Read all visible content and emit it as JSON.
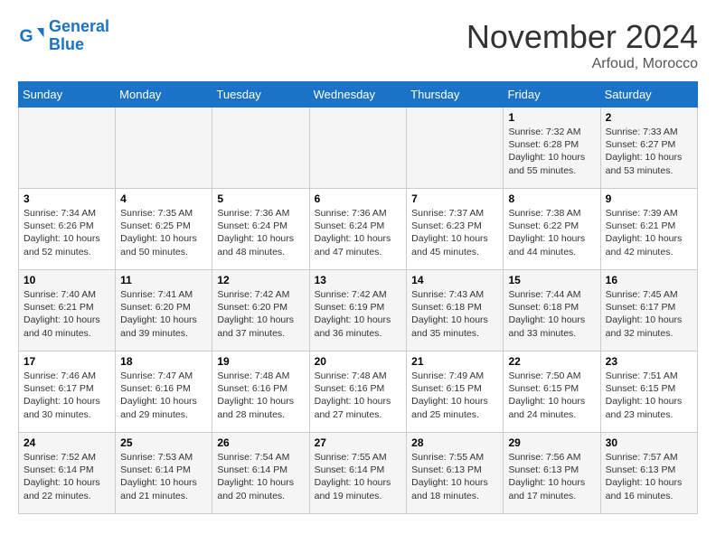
{
  "header": {
    "logo_line1": "General",
    "logo_line2": "Blue",
    "month": "November 2024",
    "location": "Arfoud, Morocco"
  },
  "weekdays": [
    "Sunday",
    "Monday",
    "Tuesday",
    "Wednesday",
    "Thursday",
    "Friday",
    "Saturday"
  ],
  "weeks": [
    [
      {
        "day": "",
        "info": ""
      },
      {
        "day": "",
        "info": ""
      },
      {
        "day": "",
        "info": ""
      },
      {
        "day": "",
        "info": ""
      },
      {
        "day": "",
        "info": ""
      },
      {
        "day": "1",
        "info": "Sunrise: 7:32 AM\nSunset: 6:28 PM\nDaylight: 10 hours\nand 55 minutes."
      },
      {
        "day": "2",
        "info": "Sunrise: 7:33 AM\nSunset: 6:27 PM\nDaylight: 10 hours\nand 53 minutes."
      }
    ],
    [
      {
        "day": "3",
        "info": "Sunrise: 7:34 AM\nSunset: 6:26 PM\nDaylight: 10 hours\nand 52 minutes."
      },
      {
        "day": "4",
        "info": "Sunrise: 7:35 AM\nSunset: 6:25 PM\nDaylight: 10 hours\nand 50 minutes."
      },
      {
        "day": "5",
        "info": "Sunrise: 7:36 AM\nSunset: 6:24 PM\nDaylight: 10 hours\nand 48 minutes."
      },
      {
        "day": "6",
        "info": "Sunrise: 7:36 AM\nSunset: 6:24 PM\nDaylight: 10 hours\nand 47 minutes."
      },
      {
        "day": "7",
        "info": "Sunrise: 7:37 AM\nSunset: 6:23 PM\nDaylight: 10 hours\nand 45 minutes."
      },
      {
        "day": "8",
        "info": "Sunrise: 7:38 AM\nSunset: 6:22 PM\nDaylight: 10 hours\nand 44 minutes."
      },
      {
        "day": "9",
        "info": "Sunrise: 7:39 AM\nSunset: 6:21 PM\nDaylight: 10 hours\nand 42 minutes."
      }
    ],
    [
      {
        "day": "10",
        "info": "Sunrise: 7:40 AM\nSunset: 6:21 PM\nDaylight: 10 hours\nand 40 minutes."
      },
      {
        "day": "11",
        "info": "Sunrise: 7:41 AM\nSunset: 6:20 PM\nDaylight: 10 hours\nand 39 minutes."
      },
      {
        "day": "12",
        "info": "Sunrise: 7:42 AM\nSunset: 6:20 PM\nDaylight: 10 hours\nand 37 minutes."
      },
      {
        "day": "13",
        "info": "Sunrise: 7:42 AM\nSunset: 6:19 PM\nDaylight: 10 hours\nand 36 minutes."
      },
      {
        "day": "14",
        "info": "Sunrise: 7:43 AM\nSunset: 6:18 PM\nDaylight: 10 hours\nand 35 minutes."
      },
      {
        "day": "15",
        "info": "Sunrise: 7:44 AM\nSunset: 6:18 PM\nDaylight: 10 hours\nand 33 minutes."
      },
      {
        "day": "16",
        "info": "Sunrise: 7:45 AM\nSunset: 6:17 PM\nDaylight: 10 hours\nand 32 minutes."
      }
    ],
    [
      {
        "day": "17",
        "info": "Sunrise: 7:46 AM\nSunset: 6:17 PM\nDaylight: 10 hours\nand 30 minutes."
      },
      {
        "day": "18",
        "info": "Sunrise: 7:47 AM\nSunset: 6:16 PM\nDaylight: 10 hours\nand 29 minutes."
      },
      {
        "day": "19",
        "info": "Sunrise: 7:48 AM\nSunset: 6:16 PM\nDaylight: 10 hours\nand 28 minutes."
      },
      {
        "day": "20",
        "info": "Sunrise: 7:48 AM\nSunset: 6:16 PM\nDaylight: 10 hours\nand 27 minutes."
      },
      {
        "day": "21",
        "info": "Sunrise: 7:49 AM\nSunset: 6:15 PM\nDaylight: 10 hours\nand 25 minutes."
      },
      {
        "day": "22",
        "info": "Sunrise: 7:50 AM\nSunset: 6:15 PM\nDaylight: 10 hours\nand 24 minutes."
      },
      {
        "day": "23",
        "info": "Sunrise: 7:51 AM\nSunset: 6:15 PM\nDaylight: 10 hours\nand 23 minutes."
      }
    ],
    [
      {
        "day": "24",
        "info": "Sunrise: 7:52 AM\nSunset: 6:14 PM\nDaylight: 10 hours\nand 22 minutes."
      },
      {
        "day": "25",
        "info": "Sunrise: 7:53 AM\nSunset: 6:14 PM\nDaylight: 10 hours\nand 21 minutes."
      },
      {
        "day": "26",
        "info": "Sunrise: 7:54 AM\nSunset: 6:14 PM\nDaylight: 10 hours\nand 20 minutes."
      },
      {
        "day": "27",
        "info": "Sunrise: 7:55 AM\nSunset: 6:14 PM\nDaylight: 10 hours\nand 19 minutes."
      },
      {
        "day": "28",
        "info": "Sunrise: 7:55 AM\nSunset: 6:13 PM\nDaylight: 10 hours\nand 18 minutes."
      },
      {
        "day": "29",
        "info": "Sunrise: 7:56 AM\nSunset: 6:13 PM\nDaylight: 10 hours\nand 17 minutes."
      },
      {
        "day": "30",
        "info": "Sunrise: 7:57 AM\nSunset: 6:13 PM\nDaylight: 10 hours\nand 16 minutes."
      }
    ]
  ]
}
